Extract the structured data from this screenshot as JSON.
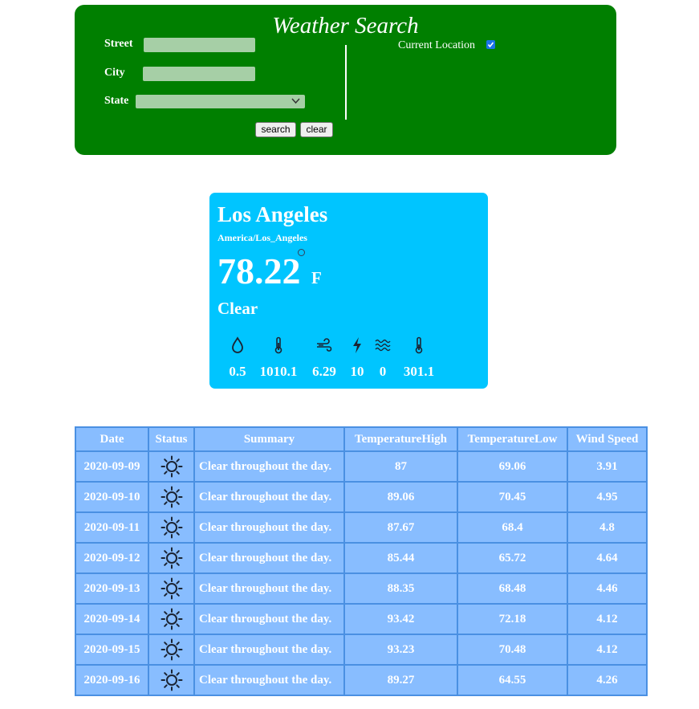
{
  "search": {
    "title": "Weather Search",
    "street_label": "Street",
    "street_value": "",
    "city_label": "City",
    "city_value": "",
    "state_label": "State",
    "state_value": "",
    "current_location_label": "Current Location",
    "current_location_checked": true,
    "search_button": "search",
    "clear_button": "clear"
  },
  "current": {
    "city": "Los Angeles",
    "timezone": "America/Los_Angeles",
    "temperature": "78.22",
    "unit": "F",
    "summary": "Clear",
    "metrics": [
      {
        "icon": "humidity-icon",
        "value": "0.5"
      },
      {
        "icon": "pressure-icon",
        "value": "1010.1"
      },
      {
        "icon": "wind-speed-icon",
        "value": "6.29"
      },
      {
        "icon": "visibility-icon",
        "value": "10"
      },
      {
        "icon": "cloud-cover-icon",
        "value": "0"
      },
      {
        "icon": "ozone-icon",
        "value": "301.1"
      }
    ]
  },
  "forecast": {
    "headers": [
      "Date",
      "Status",
      "Summary",
      "TemperatureHigh",
      "TemperatureLow",
      "Wind Speed"
    ],
    "rows": [
      {
        "date": "2020-09-09",
        "status": "sun-icon",
        "summary": "Clear throughout the day.",
        "high": "87",
        "low": "69.06",
        "wind": "3.91"
      },
      {
        "date": "2020-09-10",
        "status": "sun-icon",
        "summary": "Clear throughout the day.",
        "high": "89.06",
        "low": "70.45",
        "wind": "4.95"
      },
      {
        "date": "2020-09-11",
        "status": "sun-icon",
        "summary": "Clear throughout the day.",
        "high": "87.67",
        "low": "68.4",
        "wind": "4.8"
      },
      {
        "date": "2020-09-12",
        "status": "sun-icon",
        "summary": "Clear throughout the day.",
        "high": "85.44",
        "low": "65.72",
        "wind": "4.64"
      },
      {
        "date": "2020-09-13",
        "status": "sun-icon",
        "summary": "Clear throughout the day.",
        "high": "88.35",
        "low": "68.48",
        "wind": "4.46"
      },
      {
        "date": "2020-09-14",
        "status": "sun-icon",
        "summary": "Clear throughout the day.",
        "high": "93.42",
        "low": "72.18",
        "wind": "4.12"
      },
      {
        "date": "2020-09-15",
        "status": "sun-icon",
        "summary": "Clear throughout the day.",
        "high": "93.23",
        "low": "70.48",
        "wind": "4.12"
      },
      {
        "date": "2020-09-16",
        "status": "sun-icon",
        "summary": "Clear throughout the day.",
        "high": "89.27",
        "low": "64.55",
        "wind": "4.26"
      }
    ]
  },
  "colors": {
    "panel_green": "#007f00",
    "card_blue": "#00c5ff",
    "table_blue": "#88bdff",
    "table_border": "#4a90e2"
  }
}
